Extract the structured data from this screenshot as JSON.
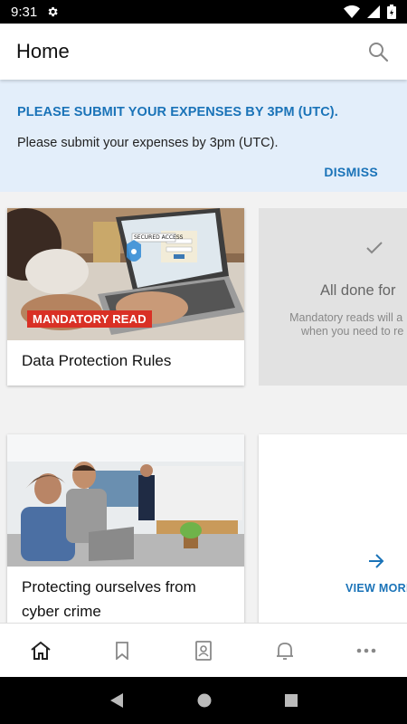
{
  "status_bar": {
    "time": "9:31"
  },
  "app_bar": {
    "title": "Home"
  },
  "banner": {
    "title": "PLEASE SUBMIT YOUR EXPENSES BY 3PM (UTC).",
    "text": "Please submit your expenses by 3pm (UTC).",
    "dismiss_label": "DISMISS"
  },
  "cards": [
    {
      "badge": "MANDATORY READ",
      "title": "Data Protection Rules",
      "image_text": "SECURED ACCESS"
    },
    {
      "title": "Protecting ourselves from cyber crime"
    }
  ],
  "done_card": {
    "title": "All done for",
    "text_line1": "Mandatory reads will a",
    "text_line2": "when you need to re"
  },
  "more_card": {
    "label": "VIEW MORE"
  },
  "bottom_nav": {
    "items": [
      "home-icon",
      "bookmark-icon",
      "contacts-icon",
      "bell-icon",
      "more-icon"
    ]
  },
  "colors": {
    "accent": "#1a73b8",
    "badge": "#d93025",
    "banner_bg": "#e3eefa"
  }
}
